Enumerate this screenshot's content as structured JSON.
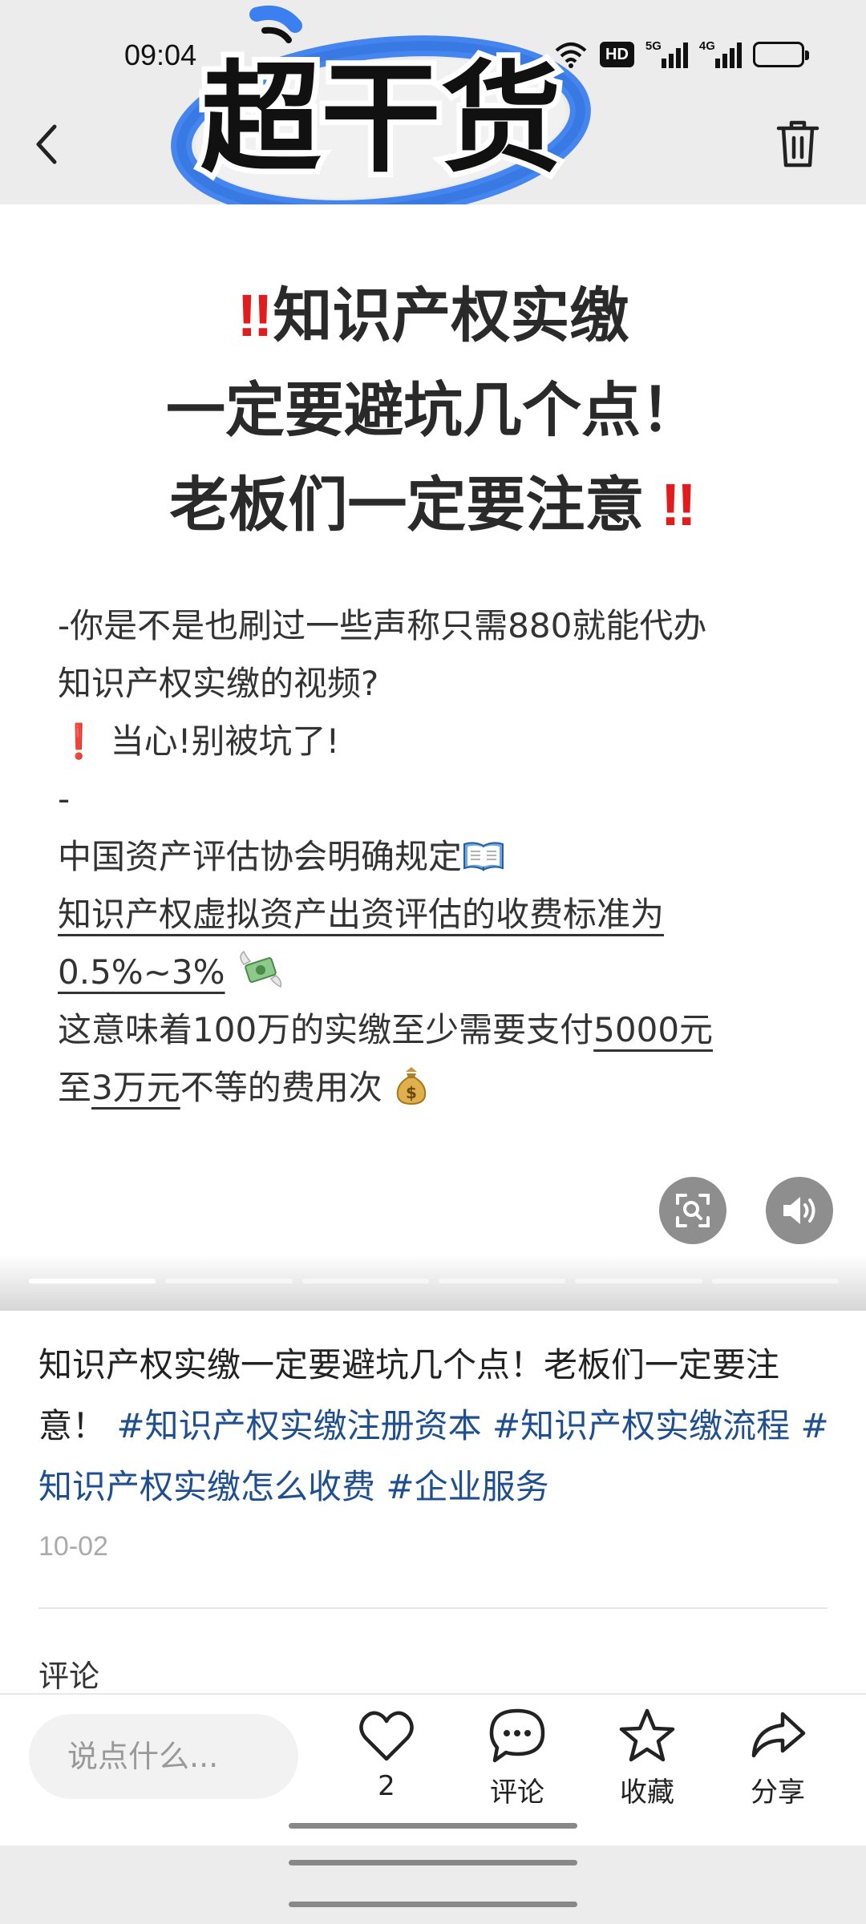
{
  "status_bar": {
    "time": "09:04",
    "network_badge": "HD",
    "signal_1_label": "5G",
    "signal_2_label": "4G"
  },
  "nav": {
    "back_icon": "chevron-left-icon",
    "delete_icon": "trash-icon"
  },
  "sticker": {
    "text": "超干货",
    "color": "#3b7ff0"
  },
  "headline": {
    "line1": "知识产权实缴",
    "line2": "一定要避坑几个点！",
    "line3": "老板们一定要注意"
  },
  "body": {
    "line1": "-你是不是也刷过一些声称只需880就能代办",
    "line2": "知识产权实缴的视频?",
    "line3": "当心!别被坑了!",
    "line4": "-",
    "line5": "中国资产评估协会明确规定",
    "line6": "知识产权虚拟资产出资评估的收费标准为",
    "line7": "0.5%~3%",
    "line8_a": "这意味着100万的实缴至少需要支付",
    "line8_b": "5000元",
    "line9_a": "至",
    "line9_b": "3万元",
    "line9_c": "不等的费用次"
  },
  "media_controls": {
    "scan_icon": "scan-icon",
    "sound_icon": "speaker-icon"
  },
  "caption": {
    "text": "知识产权实缴一定要避坑几个点！老板们一定要注意！",
    "tags": [
      "#知识产权实缴注册资本",
      "#知识产权实缴流程",
      "#知识产权实缴怎么收费",
      "#企业服务"
    ]
  },
  "date": "10-02",
  "comments": {
    "label": "评论"
  },
  "bottom_bar": {
    "input_placeholder": "说点什么...",
    "like_count": "2",
    "comment_label": "评论",
    "favorite_label": "收藏",
    "share_label": "分享"
  },
  "colors": {
    "accent_blue": "#1f4f8f",
    "alert_red": "#e21c1c",
    "sticker_blue": "#3b7ff0"
  }
}
